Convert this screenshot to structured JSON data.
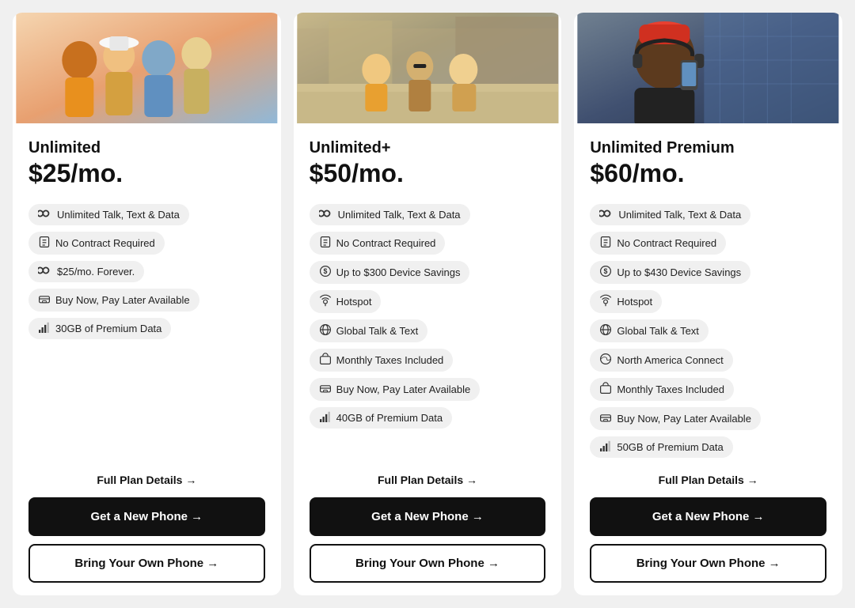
{
  "plans": [
    {
      "id": "unlimited",
      "name": "Unlimited",
      "price": "$25/mo.",
      "image_alt": "Group of friends looking up",
      "image_colors": [
        "#e8c4a0",
        "#d4956a",
        "#f0d080",
        "#a0c4e8"
      ],
      "features": [
        {
          "icon": "∞",
          "label": "Unlimited Talk, Text & Data"
        },
        {
          "icon": "📋",
          "label": "No Contract Required"
        },
        {
          "icon": "∞",
          "label": "$25/mo. Forever."
        },
        {
          "icon": "🏦",
          "label": "Buy Now, Pay Later Available"
        },
        {
          "icon": "📶",
          "label": "30GB of Premium Data"
        }
      ],
      "full_plan_label": "Full Plan Details →",
      "get_phone_label": "Get a New Phone →",
      "byop_label": "Bring Your Own Phone →"
    },
    {
      "id": "unlimited-plus",
      "name": "Unlimited+",
      "price": "$50/mo.",
      "image_alt": "Friends sitting outside building",
      "image_colors": [
        "#c4b090",
        "#a09070",
        "#b0a890",
        "#8090a0"
      ],
      "features": [
        {
          "icon": "∞",
          "label": "Unlimited Talk, Text & Data"
        },
        {
          "icon": "📋",
          "label": "No Contract Required"
        },
        {
          "icon": "$",
          "label": "Up to $300 Device Savings"
        },
        {
          "icon": "📡",
          "label": "Hotspot"
        },
        {
          "icon": "🌐",
          "label": "Global Talk & Text"
        },
        {
          "icon": "💰",
          "label": "Monthly Taxes Included"
        },
        {
          "icon": "🏦",
          "label": "Buy Now, Pay Later Available"
        },
        {
          "icon": "📶",
          "label": "40GB of Premium Data"
        }
      ],
      "full_plan_label": "Full Plan Details →",
      "get_phone_label": "Get a New Phone →",
      "byop_label": "Bring Your Own Phone →"
    },
    {
      "id": "unlimited-premium",
      "name": "Unlimited Premium",
      "price": "$60/mo.",
      "image_alt": "Man with headphones using phone",
      "image_colors": [
        "#708090",
        "#506080",
        "#304060",
        "#405070"
      ],
      "features": [
        {
          "icon": "∞",
          "label": "Unlimited Talk, Text & Data"
        },
        {
          "icon": "📋",
          "label": "No Contract Required"
        },
        {
          "icon": "$",
          "label": "Up to $430 Device Savings"
        },
        {
          "icon": "📡",
          "label": "Hotspot"
        },
        {
          "icon": "🌐",
          "label": "Global Talk & Text"
        },
        {
          "icon": "🌎",
          "label": "North America Connect"
        },
        {
          "icon": "💰",
          "label": "Monthly Taxes Included"
        },
        {
          "icon": "🏦",
          "label": "Buy Now, Pay Later Available"
        },
        {
          "icon": "📶",
          "label": "50GB of Premium Data"
        }
      ],
      "full_plan_label": "Full Plan Details →",
      "get_phone_label": "Get a New Phone →",
      "byop_label": "Bring Your Own Phone →"
    }
  ]
}
